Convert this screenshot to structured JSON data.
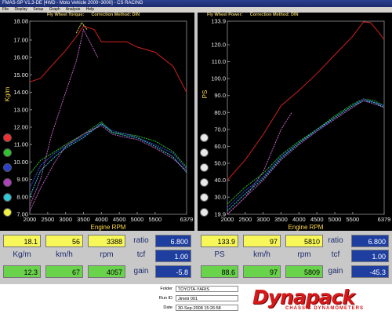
{
  "window": {
    "title": "FMAS-SP V1.3-DE  [4WD - Moto Vehicle 2000~3000] - CS RACING",
    "menu": [
      "File",
      "Display",
      "Setup",
      "Graph",
      "Analysis",
      "Help"
    ]
  },
  "left_chart": {
    "title_prefix": "Fly Wheel Torque:",
    "title_suffix": "Correction Method: DIN"
  },
  "right_chart": {
    "title_prefix": "Fly Wheel Power:",
    "title_suffix": "Correction Method: DIN"
  },
  "swatch_colors": [
    "#f03030",
    "#30c030",
    "#2a40d0",
    "#b040c0",
    "#30c8d8",
    "#f0f040"
  ],
  "swatch_colors_right": [
    "#e8e8e8",
    "#e8e8e8",
    "#e8e8e8",
    "#e8e8e8",
    "#e8e8e8",
    "#e8e8e8"
  ],
  "chart_data": [
    {
      "type": "line",
      "xlabel": "Engine RPM",
      "ylabel": "Kg/m",
      "xlim": [
        2000,
        6379
      ],
      "ylim": [
        7.0,
        18.08
      ],
      "x_ticks": [
        "2000",
        "2500",
        "3000",
        "3500",
        "4000",
        "4500",
        "5000",
        "5500",
        "6379"
      ],
      "y_ticks": [
        "7.00",
        "8.00",
        "9.00",
        "10.00",
        "11.00",
        "12.00",
        "13.00",
        "14.00",
        "15.00",
        "16.00",
        "17.00",
        "18.08"
      ],
      "series": [
        {
          "color": "#d02020",
          "x": [
            2000,
            2300,
            2600,
            3000,
            3300,
            3500,
            3800,
            4000,
            4300,
            4700,
            5000,
            5500,
            6000,
            6379
          ],
          "y": [
            14.6,
            14.8,
            15.5,
            16.4,
            17.2,
            17.8,
            17.6,
            16.9,
            16.9,
            16.9,
            16.6,
            16.3,
            15.5,
            14.0
          ]
        },
        {
          "color": "#c060c0",
          "x": [
            2000,
            2300,
            2600,
            3000,
            3300,
            3500,
            3700,
            3900
          ],
          "y": [
            7.5,
            9.0,
            11.5,
            14.0,
            15.8,
            17.6,
            16.8,
            16.0
          ]
        },
        {
          "color": "#e0e040",
          "x": [
            3300,
            3450,
            3600
          ],
          "y": [
            17.4,
            18.0,
            17.6
          ]
        },
        {
          "color": "#30c030",
          "x": [
            2000,
            2300,
            2700,
            3000,
            3500,
            4000,
            4300,
            4700,
            5000,
            5500,
            6000,
            6379
          ],
          "y": [
            9.3,
            10.1,
            10.6,
            11.0,
            11.6,
            12.3,
            11.7,
            11.6,
            11.5,
            11.2,
            10.6,
            9.7
          ]
        },
        {
          "color": "#3050e0",
          "x": [
            2000,
            2300,
            2700,
            3000,
            3500,
            4000,
            4300,
            4700,
            5000,
            5500,
            6000,
            6379
          ],
          "y": [
            8.5,
            9.8,
            10.5,
            10.9,
            11.5,
            12.2,
            11.8,
            11.6,
            11.4,
            11.0,
            10.5,
            9.6
          ]
        },
        {
          "color": "#30c8d8",
          "x": [
            2000,
            2300,
            2700,
            3000,
            3500,
            4000,
            4300,
            4700,
            5000,
            5500,
            6000,
            6379
          ],
          "y": [
            8.0,
            9.5,
            10.3,
            10.8,
            11.4,
            12.2,
            11.7,
            11.5,
            11.4,
            10.9,
            10.3,
            9.4
          ]
        },
        {
          "color": "#c060c0",
          "x": [
            2000,
            2300,
            2700,
            3000,
            3500,
            4000,
            4300,
            4700,
            5000,
            5500,
            6000,
            6379
          ],
          "y": [
            7.2,
            8.5,
            10.0,
            10.9,
            11.6,
            12.1,
            11.6,
            11.4,
            11.3,
            10.8,
            10.2,
            9.5
          ]
        }
      ]
    },
    {
      "type": "line",
      "xlabel": "Engine RPM",
      "ylabel": "PS",
      "xlim": [
        2000,
        6379
      ],
      "ylim": [
        19.9,
        133.9
      ],
      "x_ticks": [
        "2000",
        "2500",
        "3000",
        "3500",
        "4000",
        "4500",
        "5000",
        "5500",
        "6379"
      ],
      "y_ticks": [
        "19.9",
        "30.0",
        "40.0",
        "50.0",
        "60.0",
        "70.0",
        "80.0",
        "90.0",
        "100.0",
        "110.0",
        "120.0",
        "133.9"
      ],
      "series": [
        {
          "color": "#d02020",
          "x": [
            2000,
            2500,
            3000,
            3500,
            4000,
            4500,
            5000,
            5500,
            5800,
            6000,
            6200,
            6379
          ],
          "y": [
            40,
            52,
            67,
            84,
            93,
            103,
            114,
            125,
            133.5,
            133,
            128,
            123
          ]
        },
        {
          "color": "#c060c0",
          "x": [
            2000,
            2500,
            3000,
            3500,
            3800
          ],
          "y": [
            19.9,
            30,
            45,
            70,
            80
          ]
        },
        {
          "color": "#30c030",
          "x": [
            2000,
            2500,
            3000,
            3500,
            4000,
            4500,
            5000,
            5500,
            5800,
            6100,
            6379
          ],
          "y": [
            26,
            36,
            44,
            55,
            63,
            70,
            78,
            85,
            88,
            87,
            84
          ]
        },
        {
          "color": "#3050e0",
          "x": [
            2000,
            2500,
            3000,
            3500,
            4000,
            4500,
            5000,
            5500,
            5800,
            6100,
            6379
          ],
          "y": [
            24,
            34,
            42,
            54,
            62,
            69,
            77,
            84,
            88,
            86,
            84
          ]
        },
        {
          "color": "#30c8d8",
          "x": [
            2000,
            2500,
            3000,
            3500,
            4000,
            4500,
            5000,
            5500,
            5800,
            6100,
            6379
          ],
          "y": [
            22,
            32,
            41,
            53,
            62,
            70,
            77,
            84,
            87,
            86,
            83
          ]
        },
        {
          "color": "#c060c0",
          "x": [
            2000,
            2500,
            3000,
            3500,
            4000,
            4500,
            5000,
            5500,
            5800,
            6100,
            6379
          ],
          "y": [
            20,
            30,
            40,
            52,
            61,
            69,
            76,
            83,
            87,
            85,
            83
          ]
        }
      ]
    }
  ],
  "left_panel": {
    "row1": {
      "a": "18.1",
      "b": "56",
      "c": "3388",
      "ratio_label": "ratio",
      "ratio": "6.800"
    },
    "labels": {
      "unit1": "Kg/m",
      "unit2": "km/h",
      "unit3": "rpm",
      "tcf_label": "tcf",
      "tcf": "1.00"
    },
    "row3": {
      "a": "12.3",
      "b": "67",
      "c": "4057",
      "gain_label": "gain",
      "gain": "-5.8"
    }
  },
  "right_panel": {
    "row1": {
      "a": "133.9",
      "b": "97",
      "c": "5810",
      "ratio_label": "ratio",
      "ratio": "6.800"
    },
    "labels": {
      "unit1": "PS",
      "unit2": "km/h",
      "unit3": "rpm",
      "tcf_label": "tcf",
      "tcf": "1.00"
    },
    "row3": {
      "a": "88.6",
      "b": "97",
      "c": "5809",
      "gain_label": "gain",
      "gain": "-45.3"
    }
  },
  "footer": {
    "folder_label": "Folder",
    "folder": "TOYOTA-YARIS",
    "runid_label": "Run ID",
    "runid": "Jimmi 001",
    "date_label": "Date",
    "date": "30-Sep-2008 15:26:58",
    "brand": "Dynapack",
    "brand_sub": "CHASSIS DYNAMOMETERS"
  }
}
